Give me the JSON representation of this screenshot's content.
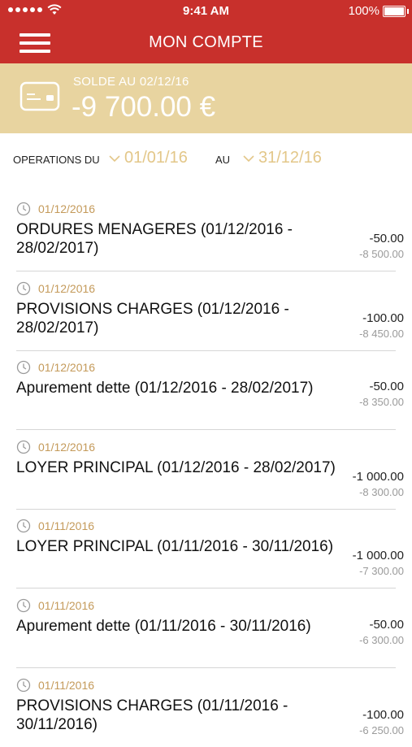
{
  "status_bar": {
    "time": "9:41 AM",
    "battery": "100%"
  },
  "header": {
    "title": "MON COMPTE"
  },
  "balance": {
    "label": "SOLDE AU 02/12/16",
    "amount": "-9 700.00 €"
  },
  "filter": {
    "from_label": "OPERATIONS DU",
    "from_date": "01/01/16",
    "to_label": "AU",
    "to_date": "31/12/16"
  },
  "operations": [
    {
      "date": "01/12/2016",
      "description": "ORDURES MENAGERES (01/12/2016 - 28/02/2017)",
      "amount": "-50.00",
      "balance": "-8 500.00"
    },
    {
      "date": "01/12/2016",
      "description": "PROVISIONS CHARGES (01/12/2016 - 28/02/2017)",
      "amount": "-100.00",
      "balance": "-8 450.00"
    },
    {
      "date": "01/12/2016",
      "description": "Apurement dette (01/12/2016 - 28/02/2017)",
      "amount": "-50.00",
      "balance": "-8 350.00"
    },
    {
      "date": "01/12/2016",
      "description": "LOYER PRINCIPAL (01/12/2016 - 28/02/2017)",
      "amount": "-1 000.00",
      "balance": "-8 300.00"
    },
    {
      "date": "01/11/2016",
      "description": "LOYER PRINCIPAL (01/11/2016 - 30/11/2016)",
      "amount": "-1 000.00",
      "balance": "-7 300.00"
    },
    {
      "date": "01/11/2016",
      "description": "Apurement dette (01/11/2016 - 30/11/2016)",
      "amount": "-50.00",
      "balance": "-6 300.00"
    },
    {
      "date": "01/11/2016",
      "description": "PROVISIONS CHARGES (01/11/2016 - 30/11/2016)",
      "amount": "-100.00",
      "balance": "-6 250.00"
    }
  ],
  "colors": {
    "header": "#c8302c",
    "balance_band": "#e8d4a0",
    "date_accent": "#c49a5a",
    "filter_date": "#e3c789"
  },
  "icons": {
    "menu": "hamburger-icon",
    "card": "card-icon",
    "clock": "clock-icon",
    "chevron": "chevron-down-icon"
  }
}
